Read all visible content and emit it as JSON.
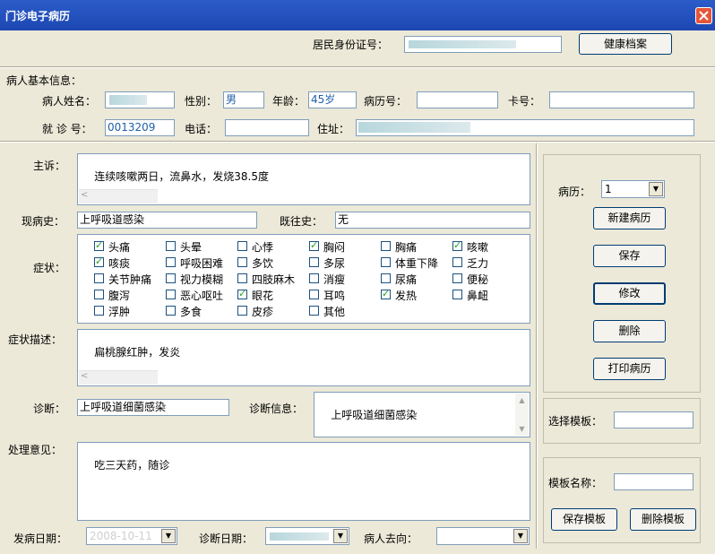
{
  "window": {
    "title": "门诊电子病历"
  },
  "top": {
    "id_label": "居民身份证号：",
    "health_record_button": "健康档案"
  },
  "patient_info": {
    "section_label": "病人基本信息：",
    "name_label": "病人姓名：",
    "gender_label": "性别：",
    "gender": "男",
    "age_label": "年龄：",
    "age": "45岁",
    "record_no_label": "病历号：",
    "card_no_label": "卡号：",
    "visit_no_label": "就 诊 号：",
    "visit_no": "0013209",
    "phone_label": "电话：",
    "address_label": "住址："
  },
  "complaint": {
    "label": "主诉：",
    "value": "连续咳嗽两日，流鼻水，发烧38.5度"
  },
  "present_history": {
    "label": "现病史：",
    "value": "上呼吸道感染"
  },
  "past_history": {
    "label": "既往史：",
    "value": "无"
  },
  "symptoms": {
    "label": "症状：",
    "items": [
      {
        "label": "头痛",
        "checked": true
      },
      {
        "label": "头晕",
        "checked": false
      },
      {
        "label": "心悸",
        "checked": false
      },
      {
        "label": "胸闷",
        "checked": true
      },
      {
        "label": "胸痛",
        "checked": false
      },
      {
        "label": "咳嗽",
        "checked": true
      },
      {
        "label": "咳痰",
        "checked": true
      },
      {
        "label": "呼吸困难",
        "checked": false
      },
      {
        "label": "多饮",
        "checked": false
      },
      {
        "label": "多尿",
        "checked": false
      },
      {
        "label": "体重下降",
        "checked": false
      },
      {
        "label": "乏力",
        "checked": false
      },
      {
        "label": "关节肿痛",
        "checked": false
      },
      {
        "label": "视力模糊",
        "checked": false
      },
      {
        "label": "四肢麻木",
        "checked": false
      },
      {
        "label": "消瘦",
        "checked": false
      },
      {
        "label": "尿痛",
        "checked": false
      },
      {
        "label": "便秘",
        "checked": false
      },
      {
        "label": "腹泻",
        "checked": false
      },
      {
        "label": "恶心呕吐",
        "checked": false
      },
      {
        "label": "眼花",
        "checked": true
      },
      {
        "label": "耳鸣",
        "checked": false
      },
      {
        "label": "发热",
        "checked": true
      },
      {
        "label": "鼻衄",
        "checked": false
      },
      {
        "label": "浮肿",
        "checked": false
      },
      {
        "label": "多食",
        "checked": false
      },
      {
        "label": "皮疹",
        "checked": false
      },
      {
        "label": "其他",
        "checked": false
      }
    ]
  },
  "symptom_desc": {
    "label": "症状描述：",
    "value": "扁桃腺红肿，发炎"
  },
  "diagnosis": {
    "label": "诊断：",
    "value": "上呼吸道细菌感染"
  },
  "diagnosis_info": {
    "label": "诊断信息：",
    "value": "上呼吸道细菌感染"
  },
  "treatment": {
    "label": "处理意见：",
    "value": "吃三天药，随诊"
  },
  "bottom": {
    "onset_date_label": "发病日期：",
    "onset_date_value": "2008-10-11",
    "diag_date_label": "诊断日期：",
    "destination_label": "病人去向："
  },
  "right_panel": {
    "record_label": "病历：",
    "record_value": "1",
    "new_record_button": "新建病历",
    "save_button": "保存",
    "modify_button": "修改",
    "delete_button": "删除",
    "print_button": "打印病历",
    "select_template_label": "选择模板：",
    "template_name_label": "模板名称：",
    "save_template_button": "保存模板",
    "delete_template_button": "删除模板"
  },
  "icons": {
    "close": "close-icon",
    "combo_arrow": "chevron-down-icon"
  },
  "colors": {
    "titlebar": "#1d47b2",
    "window_bg": "#ece9d8",
    "value_text": "#1f5fa8"
  }
}
